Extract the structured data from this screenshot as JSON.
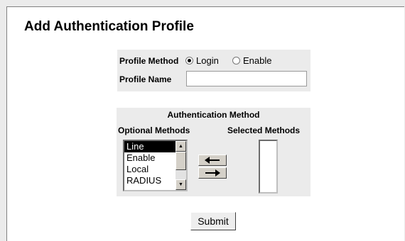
{
  "page": {
    "title": "Add Authentication Profile"
  },
  "profile": {
    "method_label": "Profile Method",
    "method_options": [
      "Login",
      "Enable"
    ],
    "method_selected": "Login",
    "name_label": "Profile Name",
    "name_value": ""
  },
  "auth": {
    "header": "Authentication Method",
    "optional_header": "Optional Methods",
    "selected_header": "Selected Methods",
    "optional_methods": [
      "Line",
      "Enable",
      "Local",
      "RADIUS"
    ],
    "highlighted": "Line",
    "selected_methods": []
  },
  "buttons": {
    "submit": "Submit"
  },
  "icons": {
    "remove": "left-arrow-icon",
    "add": "right-arrow-icon"
  }
}
